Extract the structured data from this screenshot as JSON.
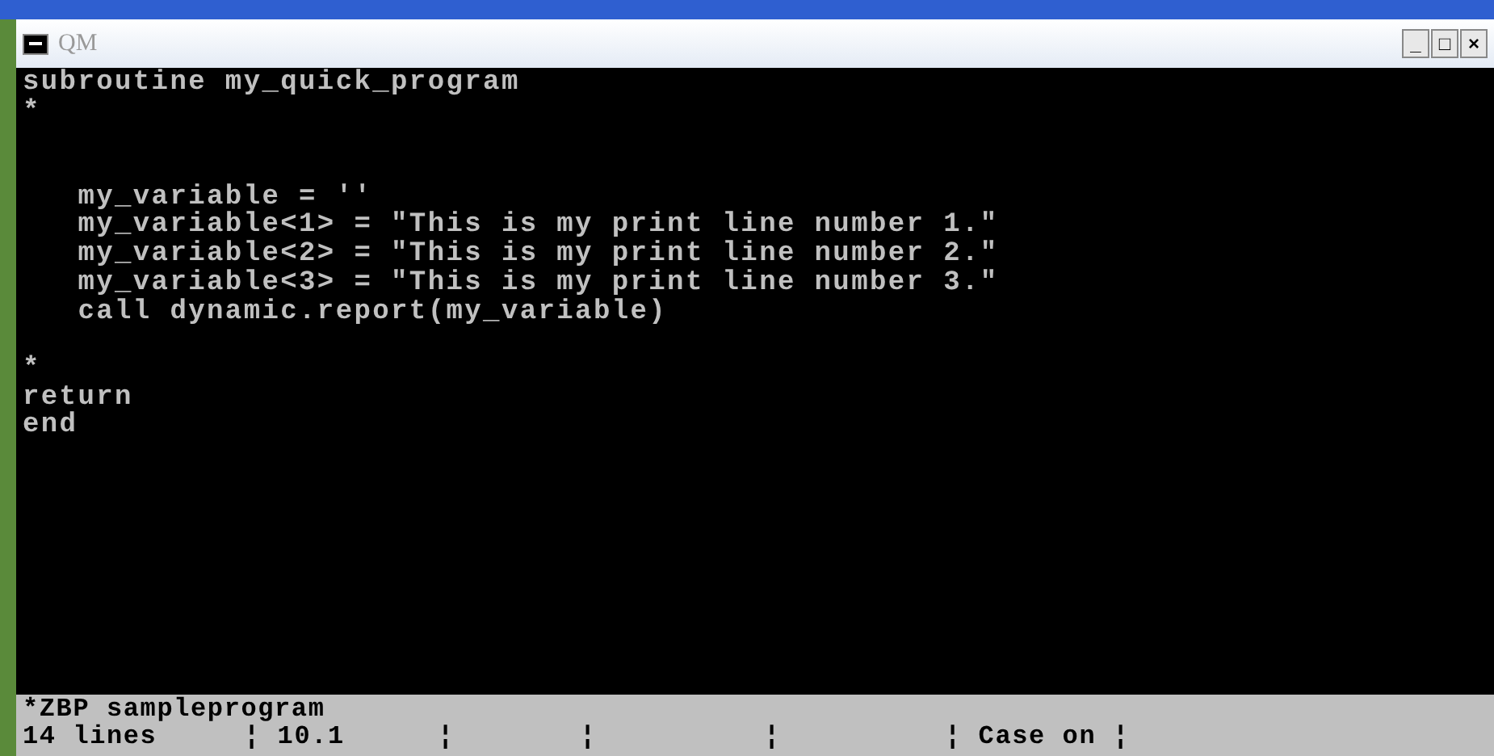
{
  "window": {
    "title": "QM",
    "controls": [
      "_",
      "□",
      "×"
    ]
  },
  "editor": {
    "lines": [
      {
        "kind": "text",
        "text": "subroutine my_quick_program"
      },
      {
        "kind": "text",
        "text": "*"
      },
      {
        "kind": "blank"
      },
      {
        "kind": "blank"
      },
      {
        "kind": "text",
        "text": "   my_variable = ''"
      },
      {
        "kind": "text",
        "text": "   my_variable<1> = \"This is my print line number 1.\""
      },
      {
        "kind": "text",
        "text": "   my_variable<2> = \"This is my print line number 2.\""
      },
      {
        "kind": "text",
        "text": "   my_variable<3> = \"This is my print line number 3.\""
      },
      {
        "kind": "text",
        "text": "   call dynamic.report(my_variable)"
      },
      {
        "kind": "blank"
      },
      {
        "kind": "text",
        "text": "*"
      },
      {
        "kind": "text",
        "text": "return"
      },
      {
        "kind": "text",
        "text": "end"
      }
    ]
  },
  "status_bar": {
    "file": "*ZBP sampleprogram",
    "fields": [
      "14 lines",
      "¦ 10.1",
      "¦",
      "¦",
      "¦",
      "¦ Case on ¦"
    ]
  }
}
